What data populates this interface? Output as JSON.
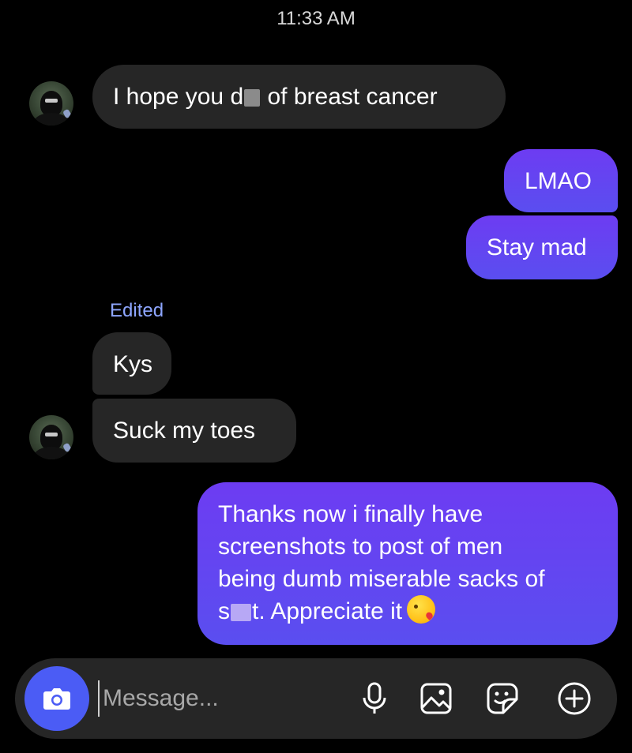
{
  "header": {
    "timestamp": "11:33 AM"
  },
  "messages": [
    {
      "side": "in",
      "text_before": "I hope you d",
      "text_after": " of breast cancer"
    },
    {
      "side": "out",
      "text": "LMAO"
    },
    {
      "side": "out",
      "text": "Stay mad"
    },
    {
      "side": "in",
      "label": "Edited",
      "text": "Kys"
    },
    {
      "side": "in",
      "text": "Suck my toes"
    },
    {
      "side": "out",
      "lines": [
        "Thanks now i finally have",
        "screenshots to post of men",
        "being dumb miserable sacks of"
      ],
      "last_before": "s",
      "last_after": "t. Appreciate it"
    }
  ],
  "composer": {
    "placeholder": "Message...",
    "icons": [
      "camera-icon",
      "microphone-icon",
      "image-icon",
      "sticker-icon",
      "add-icon"
    ]
  },
  "colors": {
    "accent": "#4b5cf5",
    "outgoing": "#6d3cf2",
    "incoming": "#262626",
    "edited": "#8ea6ff"
  }
}
